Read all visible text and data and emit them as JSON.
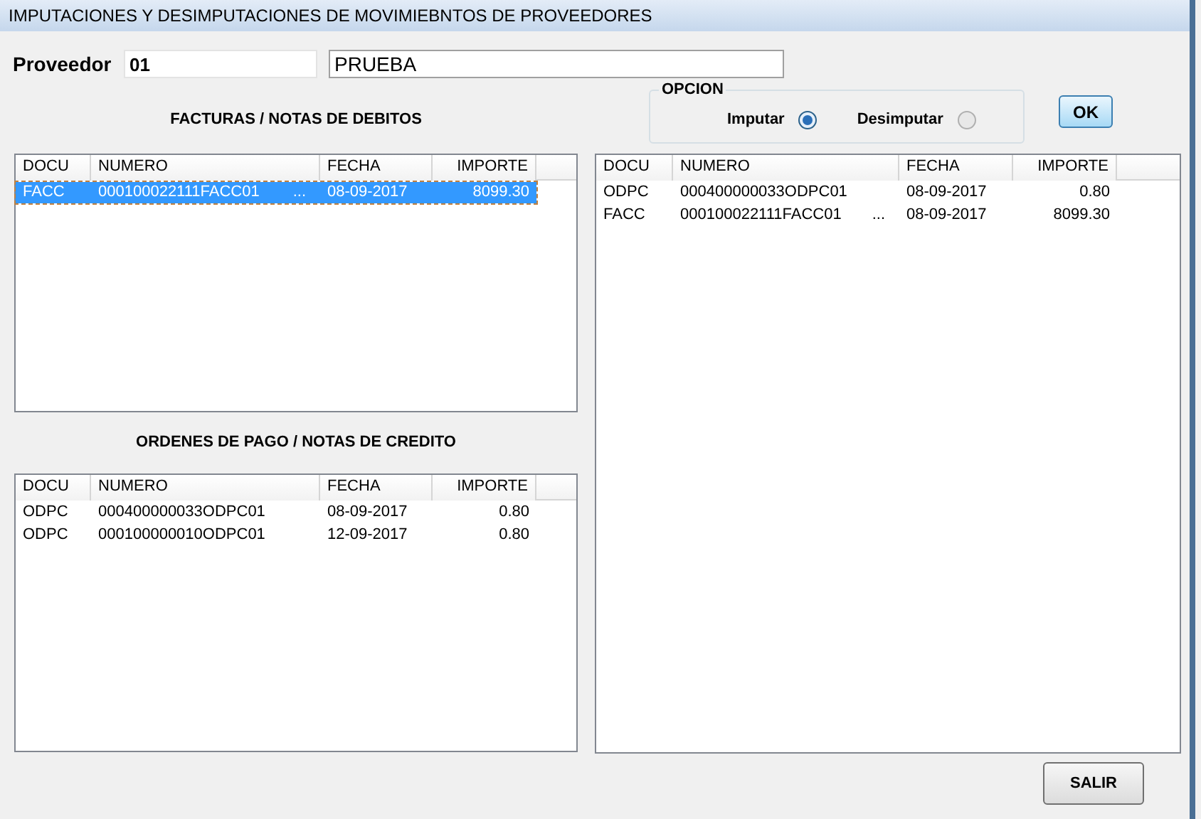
{
  "window": {
    "title": "IMPUTACIONES Y DESIMPUTACIONES DE MOVIMIEBNTOS DE PROVEEDORES"
  },
  "proveedor": {
    "label": "Proveedor",
    "code": "01",
    "name": "PRUEBA"
  },
  "opcion": {
    "title": "OPCION",
    "options": [
      {
        "label": "Imputar",
        "selected": true
      },
      {
        "label": "Desimputar",
        "selected": false
      }
    ]
  },
  "ok_button": "OK",
  "lists": [
    {
      "title": "FACTURAS / NOTAS DE DEBITOS",
      "columns": [
        "DOCU",
        "NUMERO",
        "FECHA",
        "IMPORTE"
      ],
      "rows": [
        {
          "docu": "FACC",
          "numero": "000100022111FACC01",
          "ellipsis": "...",
          "fecha": "08-09-2017",
          "importe": "8099.30",
          "selected": true
        }
      ]
    },
    {
      "title": "ORDENES DE PAGO / NOTAS DE CREDITO",
      "columns": [
        "DOCU",
        "NUMERO",
        "FECHA",
        "IMPORTE"
      ],
      "rows": [
        {
          "docu": "ODPC",
          "numero": "000400000033ODPC01",
          "fecha": "08-09-2017",
          "importe": "0.80",
          "selected": false
        },
        {
          "docu": "ODPC",
          "numero": "000100000010ODPC01",
          "fecha": "12-09-2017",
          "importe": "0.80",
          "selected": false
        }
      ]
    },
    {
      "columns": [
        "DOCU",
        "NUMERO",
        "FECHA",
        "IMPORTE"
      ],
      "rows": [
        {
          "docu": "ODPC",
          "numero": "000400000033ODPC01",
          "fecha": "08-09-2017",
          "importe": "0.80",
          "selected": false
        },
        {
          "docu": "FACC",
          "numero": "000100022111FACC01",
          "ellipsis": "...",
          "fecha": "08-09-2017",
          "importe": "8099.30",
          "selected": false
        }
      ]
    }
  ],
  "salir_button": "SALIR"
}
